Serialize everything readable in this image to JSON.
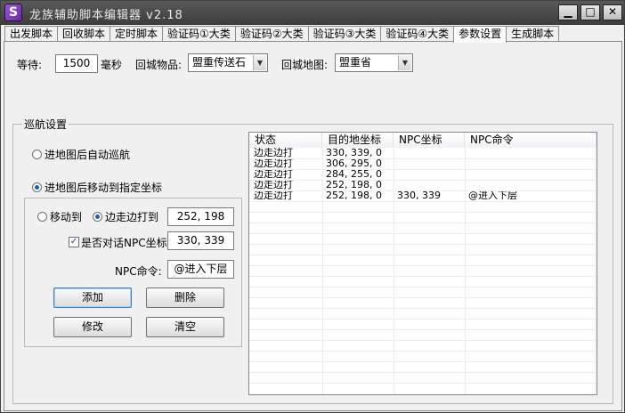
{
  "window": {
    "title": "龙族辅助脚本编辑器 v2.18",
    "icon_letter": "S",
    "minimize_label": "▁",
    "maximize_label": "□",
    "close_label": "✕"
  },
  "tabs": [
    {
      "label": "出发脚本"
    },
    {
      "label": "回收脚本"
    },
    {
      "label": "定时脚本"
    },
    {
      "label": "验证码①大类"
    },
    {
      "label": "验证码②大类"
    },
    {
      "label": "验证码③大类"
    },
    {
      "label": "验证码④大类"
    },
    {
      "label": "参数设置",
      "active": true
    },
    {
      "label": "生成脚本"
    }
  ],
  "settings": {
    "wait_label": "等待:",
    "wait_value": "1500",
    "wait_unit": "毫秒",
    "return_item_label": "回城物品:",
    "return_item_value": "盟重传送石",
    "return_map_label": "回城地图:",
    "return_map_value": "盟重省"
  },
  "patrol": {
    "group_title": "巡航设置",
    "radio_auto": "进地图后自动巡航",
    "radio_move": "进地图后移动到指定坐标",
    "radio_move_to": "移动到",
    "radio_walk_fight": "边走边打到",
    "walk_fight_coord": "252, 198",
    "npc_check_label": "是否对话NPC坐标",
    "npc_coord": "330, 339",
    "npc_cmd_label": "NPC命令:",
    "npc_cmd_value": "@进入下层",
    "btn_add": "添加",
    "btn_delete": "删除",
    "btn_modify": "修改",
    "btn_clear": "清空"
  },
  "table": {
    "columns": [
      "状态",
      "目的地坐标",
      "NPC坐标",
      "NPC命令"
    ],
    "rows": [
      [
        "边走边打",
        "330, 339, 0",
        "",
        ""
      ],
      [
        "边走边打",
        "306, 295, 0",
        "",
        ""
      ],
      [
        "边走边打",
        "284, 255, 0",
        "",
        ""
      ],
      [
        "边走边打",
        "252, 198, 0",
        "",
        ""
      ],
      [
        "边走边打",
        "252, 198, 0",
        "330, 339",
        "@进入下层"
      ]
    ]
  }
}
